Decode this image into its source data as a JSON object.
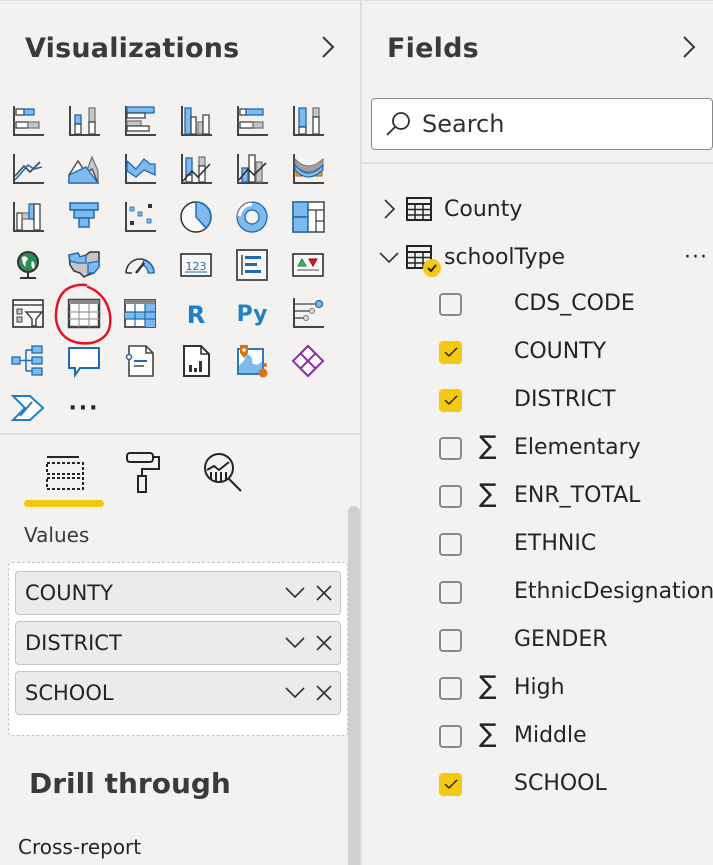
{
  "visualizations": {
    "title": "Visualizations",
    "collapse_icon": "chevron-right-icon",
    "icons": [
      {
        "name": "stacked-bar-chart-icon"
      },
      {
        "name": "stacked-column-chart-icon"
      },
      {
        "name": "clustered-bar-chart-icon"
      },
      {
        "name": "clustered-column-chart-icon"
      },
      {
        "name": "100-stacked-bar-chart-icon"
      },
      {
        "name": "100-stacked-column-chart-icon"
      },
      {
        "name": "line-chart-icon"
      },
      {
        "name": "area-chart-icon"
      },
      {
        "name": "stacked-area-chart-icon"
      },
      {
        "name": "line-and-stacked-column-chart-icon"
      },
      {
        "name": "line-and-clustered-column-chart-icon"
      },
      {
        "name": "ribbon-chart-icon"
      },
      {
        "name": "waterfall-chart-icon"
      },
      {
        "name": "funnel-icon"
      },
      {
        "name": "scatter-chart-icon"
      },
      {
        "name": "pie-chart-icon"
      },
      {
        "name": "donut-chart-icon"
      },
      {
        "name": "treemap-icon"
      },
      {
        "name": "map-icon"
      },
      {
        "name": "filled-map-icon"
      },
      {
        "name": "gauge-icon"
      },
      {
        "name": "card-icon",
        "text": "123"
      },
      {
        "name": "multi-row-card-icon"
      },
      {
        "name": "kpi-icon"
      },
      {
        "name": "slicer-icon"
      },
      {
        "name": "table-icon",
        "selected": true
      },
      {
        "name": "matrix-icon"
      },
      {
        "name": "r-script-visual-icon",
        "text": "R"
      },
      {
        "name": "python-visual-icon",
        "text": "Py"
      },
      {
        "name": "key-influencers-icon"
      },
      {
        "name": "decomposition-tree-icon"
      },
      {
        "name": "qna-icon"
      },
      {
        "name": "smart-narrative-icon"
      },
      {
        "name": "paginated-report-icon"
      },
      {
        "name": "azure-map-icon"
      },
      {
        "name": "power-apps-icon"
      },
      {
        "name": "power-automate-icon"
      },
      {
        "name": "more-visuals-icon",
        "text": "···"
      }
    ],
    "tabs": [
      {
        "name": "fields-tab",
        "icon": "fields-well-icon",
        "active": true
      },
      {
        "name": "format-tab",
        "icon": "paint-roller-icon",
        "active": false
      },
      {
        "name": "analytics-tab",
        "icon": "analytics-magnifier-icon",
        "active": false
      }
    ],
    "values_label": "Values",
    "values": [
      {
        "label": "COUNTY"
      },
      {
        "label": "DISTRICT"
      },
      {
        "label": "SCHOOL"
      }
    ],
    "drill_through_title": "Drill through",
    "cross_report_label": "Cross-report"
  },
  "fields": {
    "title": "Fields",
    "collapse_icon": "chevron-right-icon",
    "search_placeholder": "Search",
    "tables": [
      {
        "name": "County",
        "expanded": false
      },
      {
        "name": "schoolType",
        "expanded": true,
        "in_use": true,
        "more": "···"
      }
    ],
    "items": [
      {
        "label": "CDS_CODE",
        "checked": false,
        "aggregate": false
      },
      {
        "label": "COUNTY",
        "checked": true,
        "aggregate": false
      },
      {
        "label": "DISTRICT",
        "checked": true,
        "aggregate": false
      },
      {
        "label": "Elementary",
        "checked": false,
        "aggregate": true
      },
      {
        "label": "ENR_TOTAL",
        "checked": false,
        "aggregate": true
      },
      {
        "label": "ETHNIC",
        "checked": false,
        "aggregate": false
      },
      {
        "label": "EthnicDesignation",
        "checked": false,
        "aggregate": false
      },
      {
        "label": "GENDER",
        "checked": false,
        "aggregate": false
      },
      {
        "label": "High",
        "checked": false,
        "aggregate": true
      },
      {
        "label": "Middle",
        "checked": false,
        "aggregate": true
      },
      {
        "label": "SCHOOL",
        "checked": true,
        "aggregate": false
      }
    ],
    "sigma_symbol": "∑"
  },
  "colors": {
    "accent_yellow": "#f2c811",
    "viz_blue": "#118dff",
    "annotation_red": "#e81123"
  }
}
